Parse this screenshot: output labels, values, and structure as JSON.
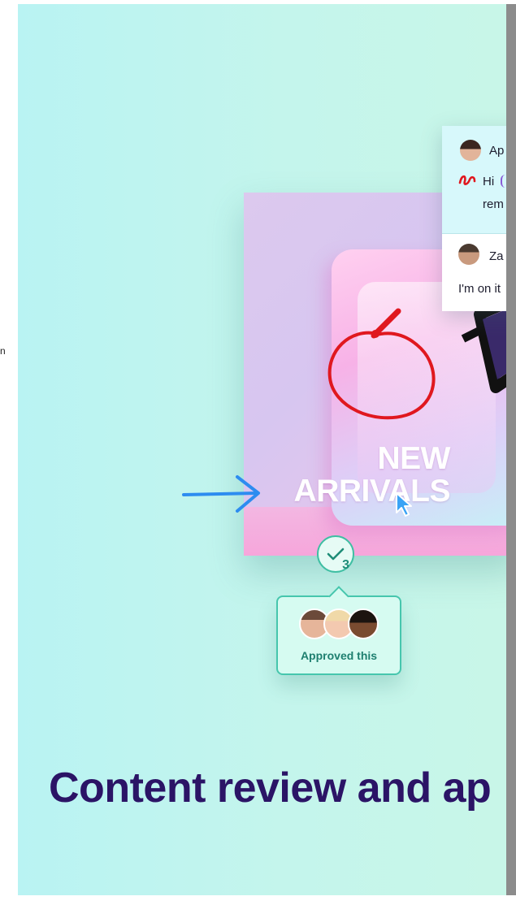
{
  "hero": {
    "title_line1": "NEW",
    "title_line2": "ARRIVALS"
  },
  "approval": {
    "count": "3",
    "label": "Approved this"
  },
  "comments": [
    {
      "name_partial": "Ap",
      "line1": "Hi",
      "line2": "rem"
    },
    {
      "name_partial": "Za",
      "line1": "I'm on it"
    }
  ],
  "headline": "Content review and ap",
  "icons": [
    "check-icon",
    "scribble-annotation",
    "arrow-annotation",
    "cursor-icon",
    "signature-icon"
  ],
  "colors": {
    "annotation_red": "#e0181f",
    "annotation_blue": "#2d8cf0",
    "approve_teal": "#3fbfa3",
    "headline_purple": "#2b1466"
  },
  "stray_char": "n"
}
